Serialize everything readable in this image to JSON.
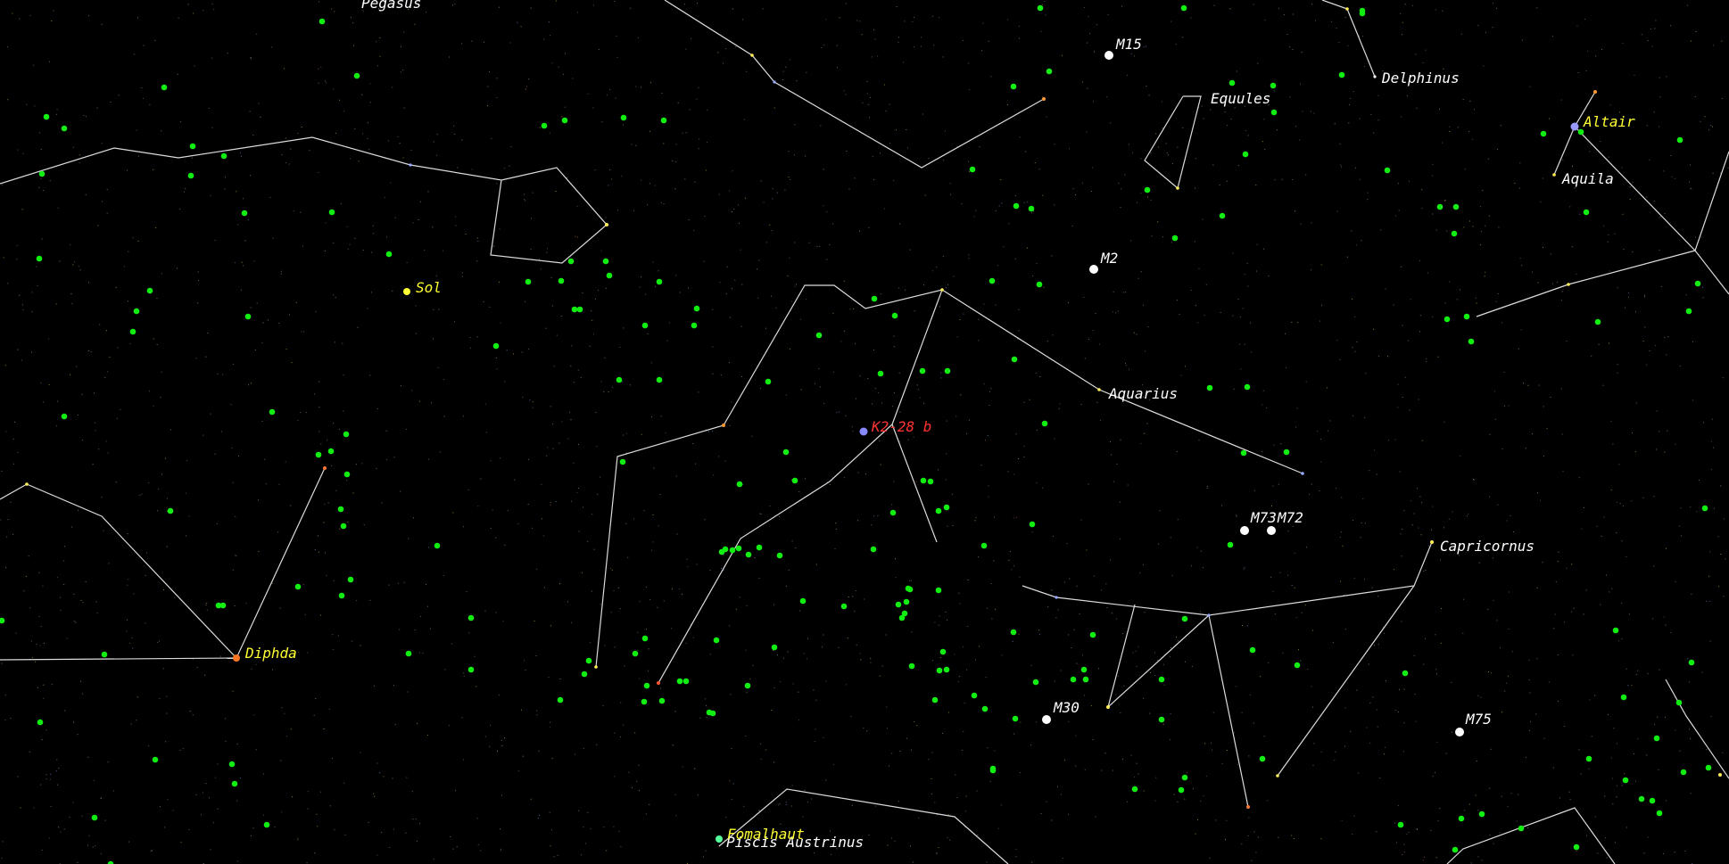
{
  "colors": {
    "background": "#000000",
    "constellation_line": "#dcdcdc",
    "galaxy_marker": "#11ee11",
    "messier_marker": "#ffffff",
    "named_star_label": "#ffff33",
    "target_label": "#ff3333",
    "target_marker": "#8888ff",
    "constellation_label": "#ffffff"
  },
  "constellation_labels": {
    "pegasus": "Pegasus",
    "delphinus": "Delphinus",
    "equules": "Equules",
    "aquila": "Aquila",
    "aquarius": "Aquarius",
    "capricornus": "Capricornus",
    "piscis_austrinus": "Piscis Austrinus"
  },
  "messier_labels": {
    "m15": "M15",
    "m2": "M2",
    "m73": "M73",
    "m72": "M72",
    "m30": "M30",
    "m75": "M75"
  },
  "named_stars": {
    "sol": "Sol",
    "diphda": "Diphda",
    "altair": "Altair",
    "fomalhaut": "Fomalhaut"
  },
  "target": {
    "name": "K2-28 b",
    "icon": "planet-marker-icon"
  },
  "galaxy_icon": "green-dot-icon"
}
